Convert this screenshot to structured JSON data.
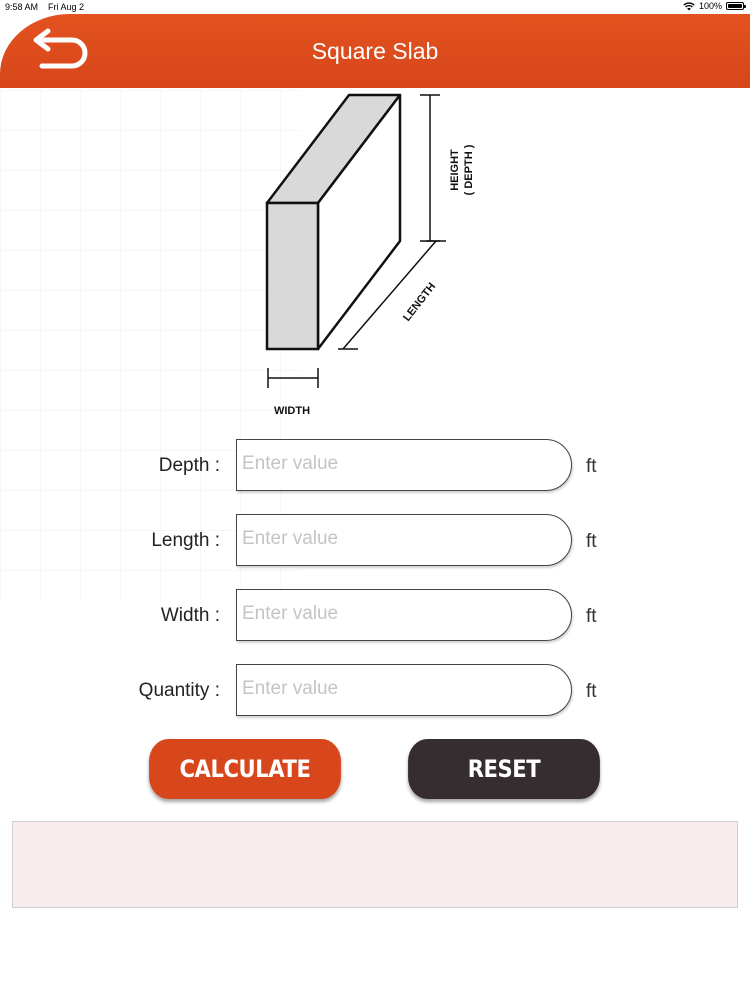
{
  "status_bar": {
    "time": "9:58 AM",
    "date": "Fri Aug 2",
    "battery": "100%"
  },
  "header": {
    "title": "Square Slab",
    "back_icon": "back-arrow-icon"
  },
  "diagram": {
    "height_label": "HEIGHT",
    "depth_label": "( DEPTH )",
    "length_label": "LENGTH",
    "width_label": "WIDTH"
  },
  "fields": [
    {
      "label": "Depth :",
      "placeholder": "Enter value",
      "value": "",
      "unit": "ft"
    },
    {
      "label": "Length :",
      "placeholder": "Enter value",
      "value": "",
      "unit": "ft"
    },
    {
      "label": "Width :",
      "placeholder": "Enter value",
      "value": "",
      "unit": "ft"
    },
    {
      "label": "Quantity :",
      "placeholder": "Enter value",
      "value": "",
      "unit": "ft"
    }
  ],
  "buttons": {
    "calculate": "CALCULATE",
    "reset": "RESET"
  },
  "result": {
    "text": ""
  },
  "colors": {
    "accent": "#d8461c",
    "dark_button": "#352d2f",
    "result_bg": "#f9ecec"
  }
}
